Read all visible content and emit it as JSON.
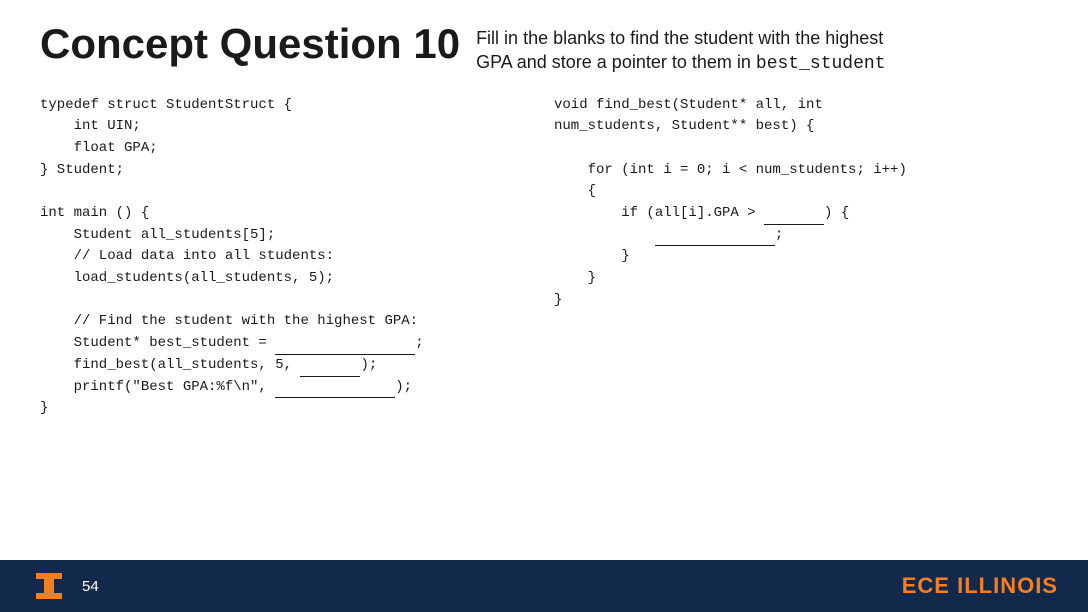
{
  "header": {
    "title": "Concept Question 10",
    "description_line1": "Fill in the blanks to find the student with the highest",
    "description_line2": "GPA and store a pointer to them in best_student"
  },
  "left_code": {
    "lines": [
      "typedef struct StudentStruct {",
      "    int UIN;",
      "    float GPA;",
      "} Student;",
      "",
      "int main () {",
      "    Student all_students[5];",
      "    // Load data into all students:",
      "    load_students(all_students, 5);",
      "",
      "    // Find the student with the highest GPA:",
      "    Student* best_student = _________________;",
      "    find_best(all_students, 5, ____________);",
      "    printf(\"Best GPA:%f\\n\", ________________);",
      "}"
    ]
  },
  "right_code": {
    "lines": [
      "void find_best(Student* all, int",
      "num_students, Student** best) {",
      "",
      "    for (int i = 0; i < num_students; i++)",
      "    {",
      "        if (all[i].GPA > ___________) {",
      "            _______________;",
      "        }",
      "    }",
      "}"
    ]
  },
  "footer": {
    "page_number": "54",
    "brand": "ECE ILLINOIS"
  }
}
